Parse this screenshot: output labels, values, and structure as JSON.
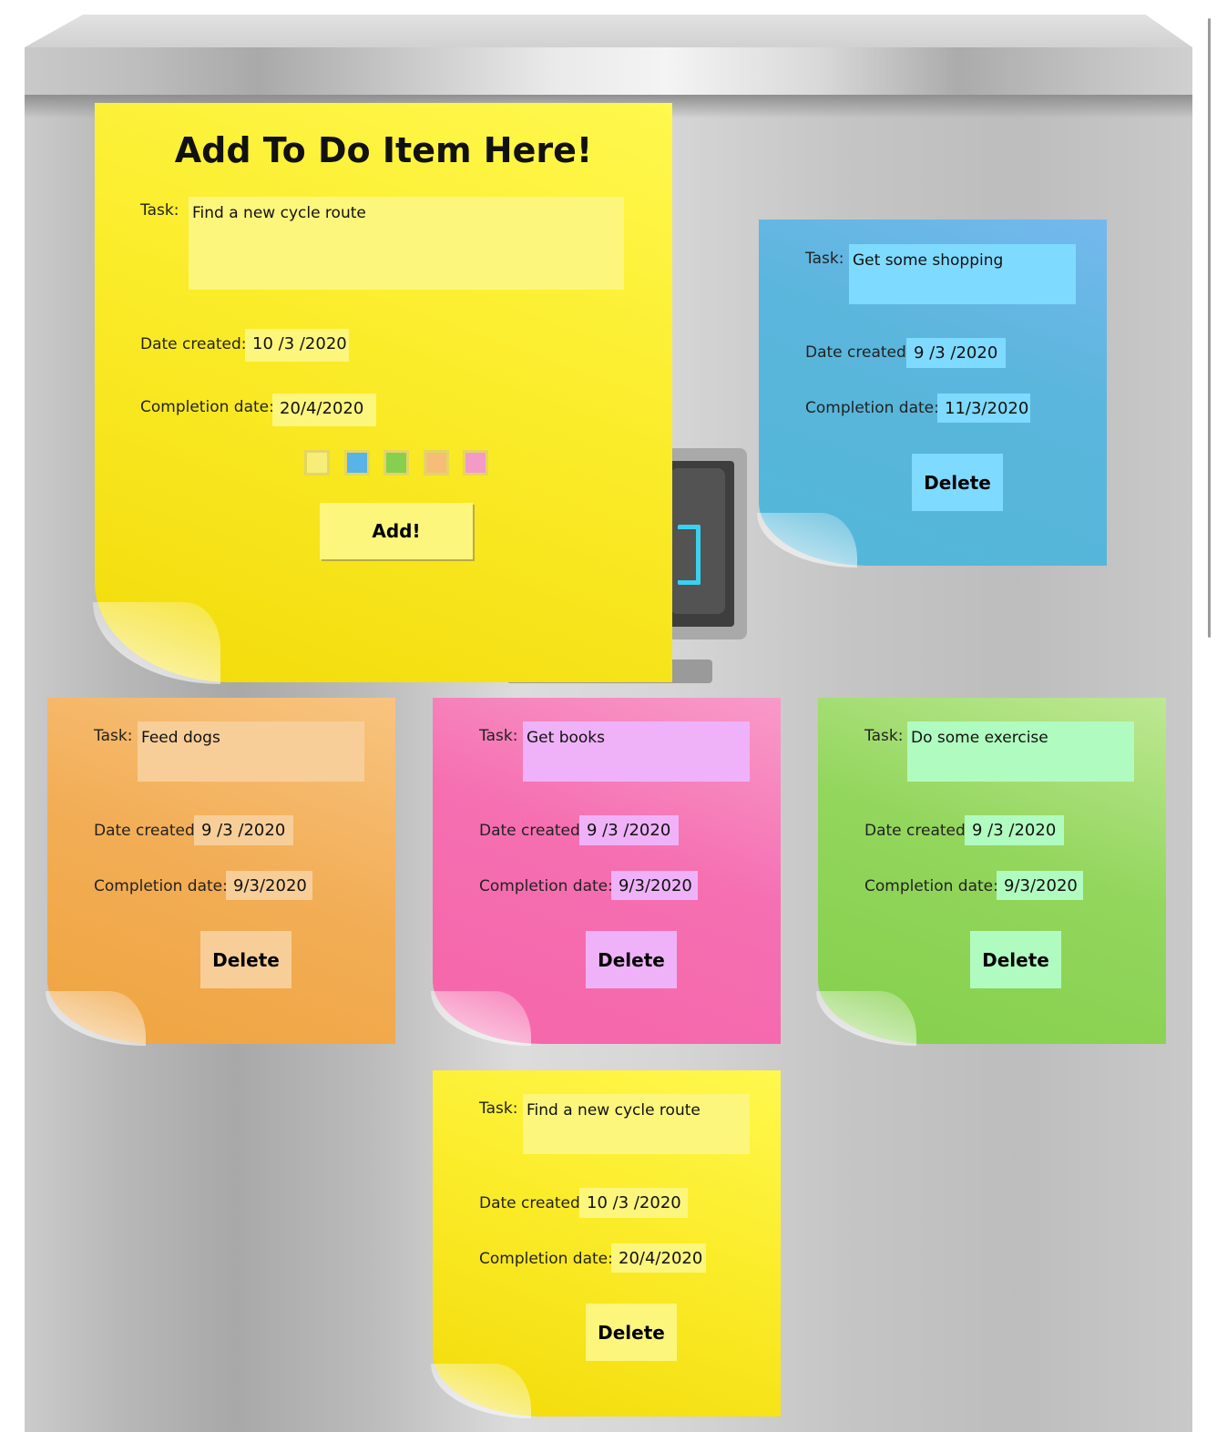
{
  "form": {
    "title": "Add To Do Item Here!",
    "task_label": "Task:",
    "task_value": "Find a new cycle route",
    "date_created_label": "Date created:",
    "date_created_value": "10 /3 /2020",
    "completion_label": "Completion date:",
    "completion_value": "20/4/2020",
    "swatches": [
      "#f7ee7a",
      "#58b3e6",
      "#86cf4f",
      "#f6bd78",
      "#f49ac9"
    ],
    "add_label": "Add!"
  },
  "notes": [
    {
      "color": "blue",
      "task_label": "Task:",
      "task": "Get some shopping",
      "date_created_label": "Date created:",
      "date_created": "9 /3 /2020",
      "completion_label": "Completion date:",
      "completion": "11/3/2020",
      "delete_label": "Delete"
    },
    {
      "color": "orange",
      "task_label": "Task:",
      "task": "Feed dogs",
      "date_created_label": "Date created:",
      "date_created": "9 /3 /2020",
      "completion_label": "Completion date:",
      "completion": "9/3/2020",
      "delete_label": "Delete"
    },
    {
      "color": "pink",
      "task_label": "Task:",
      "task": "Get books",
      "date_created_label": "Date created:",
      "date_created": "9 /3 /2020",
      "completion_label": "Completion date:",
      "completion": "9/3/2020",
      "delete_label": "Delete"
    },
    {
      "color": "green",
      "task_label": "Task:",
      "task": "Do some exercise",
      "date_created_label": "Date created:",
      "date_created": "9 /3 /2020",
      "completion_label": "Completion date:",
      "completion": "9/3/2020",
      "delete_label": "Delete"
    },
    {
      "color": "yellow",
      "task_label": "Task:",
      "task": "Find a new cycle route",
      "date_created_label": "Date created:",
      "date_created": "10 /3 /2020",
      "completion_label": "Completion date:",
      "completion": "20/4/2020",
      "delete_label": "Delete"
    }
  ]
}
